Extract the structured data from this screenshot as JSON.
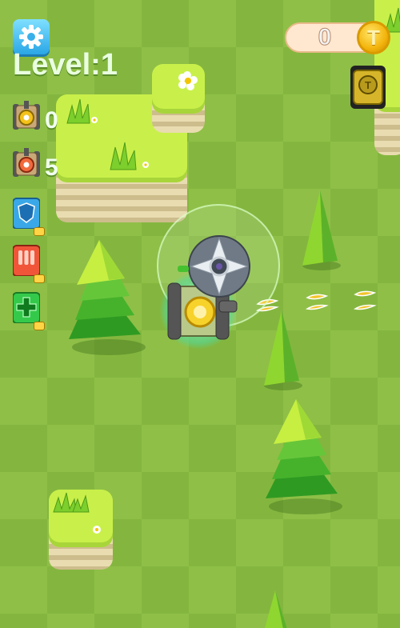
{
  "hud": {
    "settings_icon": "gear-icon",
    "level_text": "Level:1",
    "coin_count": "0",
    "coin_symbol": "T"
  },
  "side_items": [
    {
      "name": "yellow-tank",
      "count": "0",
      "icon": "tank-yellow-icon"
    },
    {
      "name": "red-tank",
      "count": "5",
      "icon": "tank-red-icon"
    },
    {
      "name": "blue-shield-tank",
      "count": "",
      "icon": "tank-blue-shield-icon",
      "ad": true
    },
    {
      "name": "red-rocket-tank",
      "count": "",
      "icon": "tank-red-rocket-icon",
      "ad": true
    },
    {
      "name": "green-cross-tank",
      "count": "",
      "icon": "tank-green-cross-icon",
      "ad": true
    }
  ],
  "colors": {
    "grass_light": "#8fbf47",
    "grass_dark": "#84b63f",
    "platform_top": "#c9f04a",
    "coin": "#f3b40d"
  }
}
